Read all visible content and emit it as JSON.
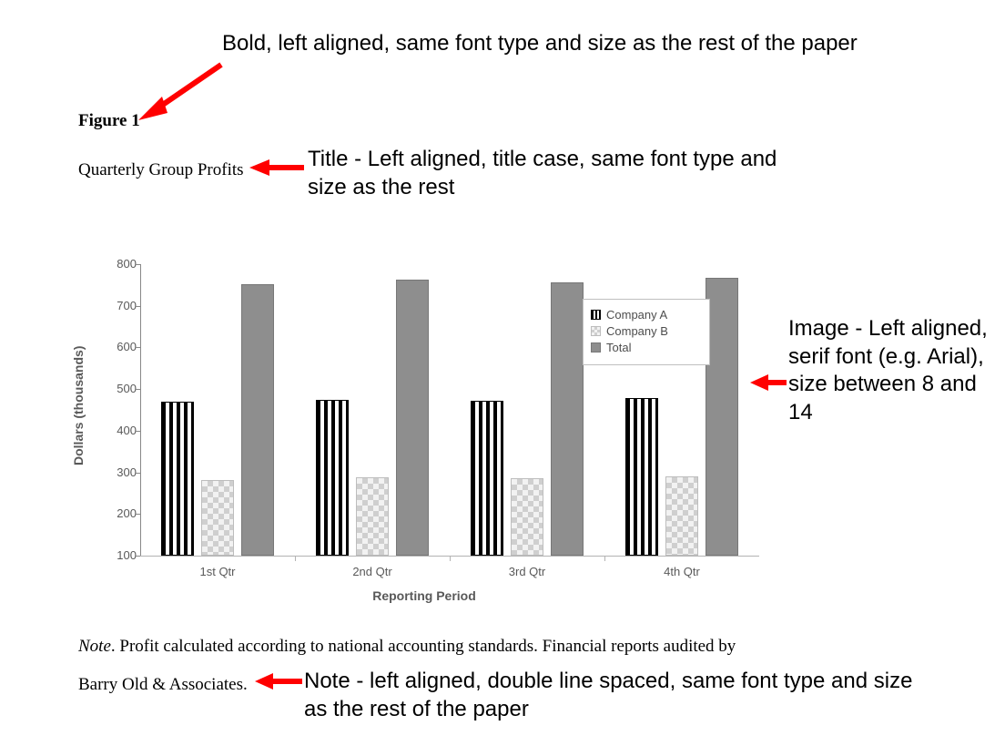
{
  "figure_label": "Figure 1",
  "figure_title": "Quarterly Group Profits",
  "note": {
    "prefix": "Note",
    "body": ". Profit calculated according to national accounting standards. Financial reports audited by Barry Old & Associates."
  },
  "annotations": {
    "a1": "Bold, left aligned, same font type and size as the rest of the paper",
    "a2": "Title - Left aligned, title case, same font type and size as the rest",
    "a3": "Image - Left aligned, serif font (e.g. Arial), size between 8 and 14",
    "a4": "Note - left aligned, double line spaced, same font type and size as the rest of the paper"
  },
  "chart_data": {
    "type": "bar",
    "title": "",
    "xlabel": "Reporting Period",
    "ylabel": "Dollars (thousands)",
    "categories": [
      "1st Qtr",
      "2nd Qtr",
      "3rd Qtr",
      "4th Qtr"
    ],
    "series": [
      {
        "name": "Company A",
        "values": [
          470,
          475,
          472,
          478
        ]
      },
      {
        "name": "Company B",
        "values": [
          282,
          288,
          285,
          290
        ]
      },
      {
        "name": "Total",
        "values": [
          752,
          763,
          757,
          768
        ]
      }
    ],
    "ylim": [
      100,
      800
    ],
    "yticks": [
      100,
      200,
      300,
      400,
      500,
      600,
      700,
      800
    ],
    "legend_position": "inside-top-right"
  }
}
